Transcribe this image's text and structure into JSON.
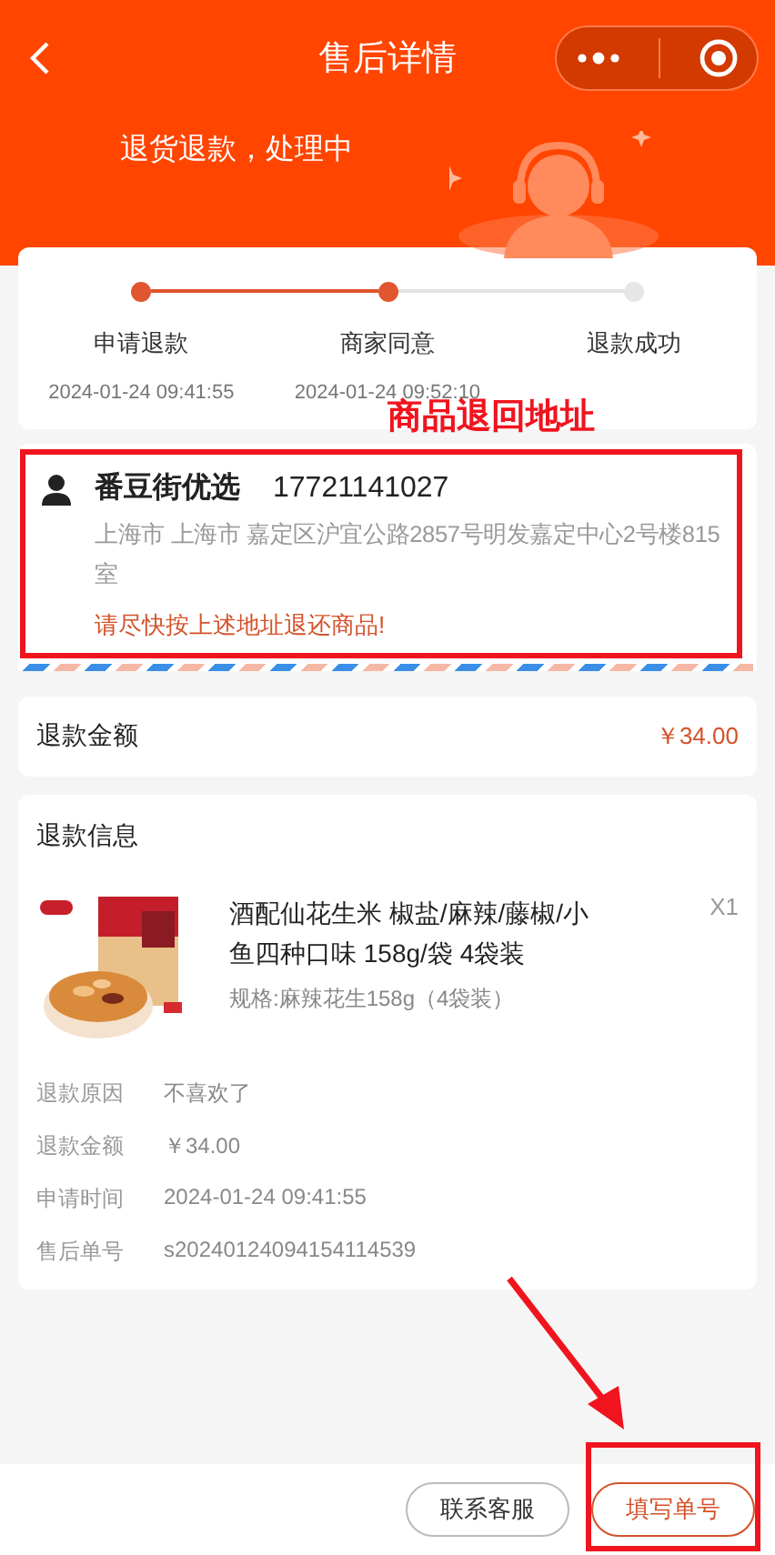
{
  "nav": {
    "title": "售后详情"
  },
  "status_text": "退货退款，处理中",
  "steps": [
    {
      "label": "申请退款",
      "time": "2024-01-24 09:41:55",
      "done": true
    },
    {
      "label": "商家同意",
      "time": "2024-01-24 09:52:10",
      "done": true
    },
    {
      "label": "退款成功",
      "done": false
    }
  ],
  "return_address": {
    "annotation": "商品退回地址",
    "name": "番豆街优选",
    "phone": "17721141027",
    "address": "上海市 上海市 嘉定区沪宜公路2857号明发嘉定中心2号楼815室",
    "notice": "请尽快按上述地址退还商品!"
  },
  "refund_amount": {
    "label": "退款金额",
    "value": "￥34.00"
  },
  "refund_info": {
    "title": "退款信息",
    "product": {
      "title": "酒配仙花生米 椒盐/麻辣/藤椒/小鱼四种口味 158g/袋 4袋装",
      "quantity": "X1",
      "spec": "规格:麻辣花生158g（4袋装）"
    },
    "rows": [
      {
        "label": "退款原因",
        "value": "不喜欢了"
      },
      {
        "label": "退款金额",
        "value": "￥34.00"
      },
      {
        "label": "申请时间",
        "value": "2024-01-24 09:41:55"
      },
      {
        "label": "售后单号",
        "value": "s20240124094154114539"
      }
    ]
  },
  "footer_buttons": [
    {
      "label": "联系客服",
      "kind": "secondary"
    },
    {
      "label": "填写单号",
      "kind": "primary"
    }
  ]
}
